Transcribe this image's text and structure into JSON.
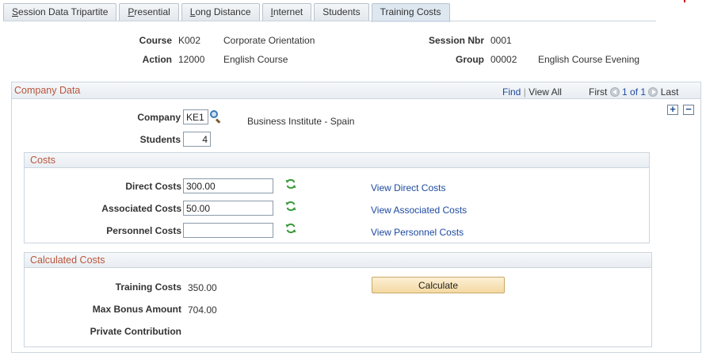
{
  "tabs": [
    {
      "label": "Session Data Tripartite",
      "mnemonic": "S",
      "rest": "ession Data Tripartite",
      "active": false
    },
    {
      "label": "Presential",
      "mnemonic": "P",
      "rest": "resential",
      "active": false
    },
    {
      "label": "Long Distance",
      "mnemonic": "L",
      "rest": "ong Distance",
      "active": false
    },
    {
      "label": "Internet",
      "mnemonic": "I",
      "rest": "nternet",
      "active": false
    },
    {
      "label": "Students",
      "mnemonic": "",
      "rest": "Students",
      "active": false
    },
    {
      "label": "Training Costs",
      "mnemonic": "",
      "rest": "Training Costs",
      "active": true
    }
  ],
  "header": {
    "course_label": "Course",
    "course_code": "K002",
    "course_desc": "Corporate Orientation",
    "action_label": "Action",
    "action_code": "12000",
    "action_desc": "English Course",
    "session_label": "Session Nbr",
    "session_value": "0001",
    "group_label": "Group",
    "group_code": "00002",
    "group_desc": "English Course Evening"
  },
  "company_data": {
    "title": "Company Data",
    "nav": {
      "find": "Find",
      "separator": "|",
      "view_all": "View All",
      "first": "First",
      "range": "1 of 1",
      "last": "Last"
    },
    "company_label": "Company",
    "company_value": "KE1",
    "company_desc": "Business Institute - Spain",
    "students_label": "Students",
    "students_value": "4"
  },
  "costs": {
    "title": "Costs",
    "direct_label": "Direct Costs",
    "direct_value": "300.00",
    "direct_link": "View Direct Costs",
    "associated_label": "Associated Costs",
    "associated_value": "50.00",
    "associated_link": "View Associated Costs",
    "personnel_label": "Personnel Costs",
    "personnel_value": "",
    "personnel_link": "View Personnel Costs"
  },
  "calculated": {
    "title": "Calculated Costs",
    "training_label": "Training Costs",
    "training_value": "350.00",
    "bonus_label": "Max Bonus Amount",
    "bonus_value": "704.00",
    "private_label": "Private Contribution",
    "private_value": "",
    "calculate_label": "Calculate"
  },
  "colors": {
    "section_title": "#b9553c",
    "link": "#1d4aa0",
    "refresh_icon": "#3a9a3a"
  }
}
